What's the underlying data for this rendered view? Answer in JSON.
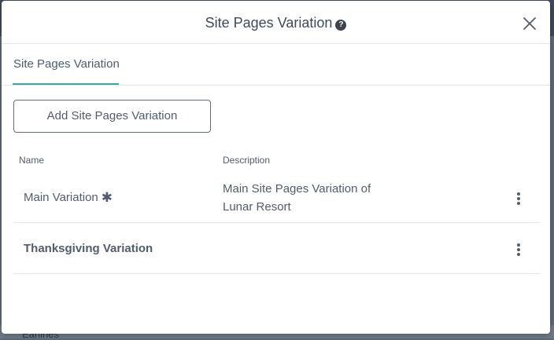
{
  "modal": {
    "title": "Site Pages Variation",
    "help_icon": "question-circle-icon",
    "close_icon": "close-icon"
  },
  "tabs": [
    {
      "label": "Site Pages Variation",
      "active": true
    }
  ],
  "add_button": {
    "label": "Add Site Pages Variation"
  },
  "table": {
    "columns": [
      "Name",
      "Description"
    ],
    "rows": [
      {
        "name": "Main Variation",
        "default_marker": "✱",
        "description": "Main Site Pages Variation of Lunar Resort"
      },
      {
        "name": "Thanksgiving Variation",
        "description": ""
      }
    ]
  },
  "background": {
    "partial_text": "Earlines"
  },
  "colors": {
    "accent": "#3aa6a5",
    "text": "#4f5d6e",
    "overlay": "#5d6a78"
  }
}
